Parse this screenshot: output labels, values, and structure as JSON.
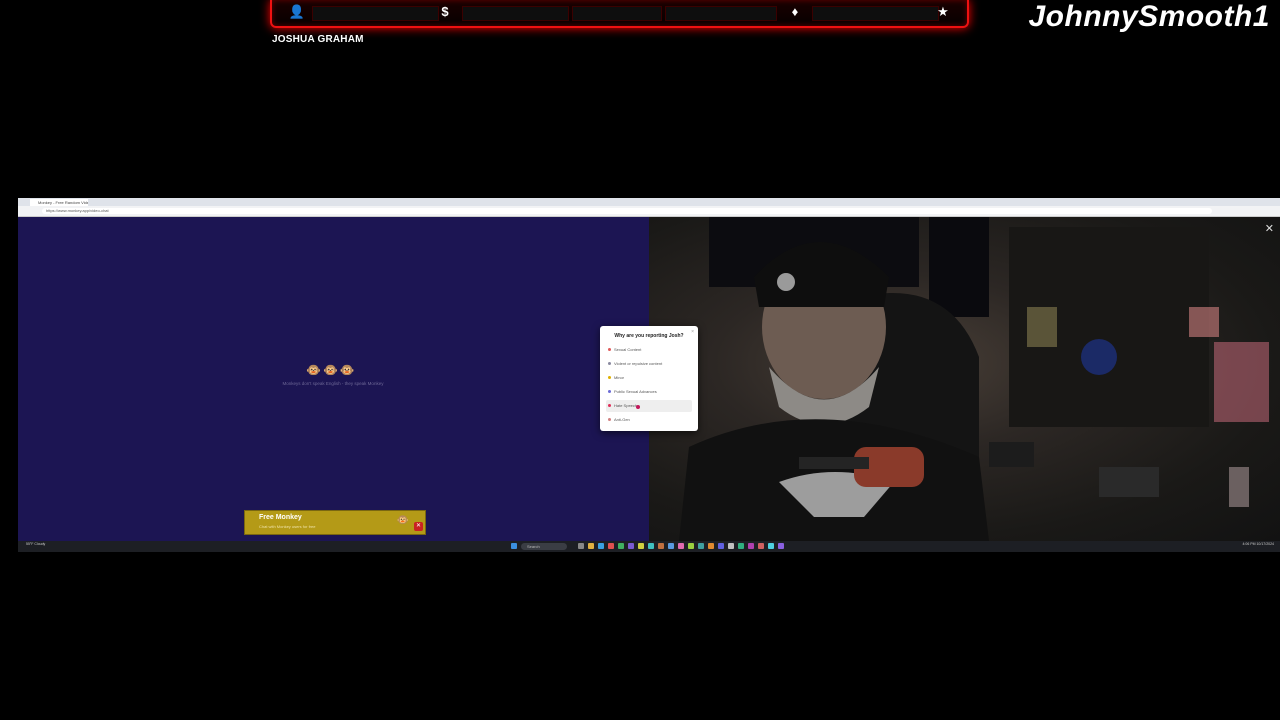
{
  "overlay": {
    "streamer_name": "JohnnySmooth1",
    "caption_name": "JOSHUA GRAHAM",
    "icons": [
      "user-icon",
      "dollar-icon",
      "diamond-icon",
      "star-icon"
    ],
    "icon_glyphs": {
      "user": "👤",
      "dollar": "$",
      "diamond": "♦",
      "star": "★"
    },
    "accent_color": "#ee1111"
  },
  "browser": {
    "tab_title": "Monkey - Free Random Video Chat",
    "address": "https://www.monkey.app/video-chat"
  },
  "page": {
    "monkeys": "🐵🐵🐵",
    "tagline": "Monkeys don't speak English - they speak Monkey",
    "ad": {
      "title": "Free Monkey",
      "subtitle": "Chat with Monkey users for free",
      "close": "✕"
    },
    "close_glyph": "✕",
    "left_bg": "#1c1553"
  },
  "report_modal": {
    "title": "Why are you reporting Josh?",
    "close": "×",
    "reasons": [
      {
        "label": "Sexual Content",
        "dot_color": "#e05a5a"
      },
      {
        "label": "Violent or repulsive content",
        "dot_color": "#8a8aa0"
      },
      {
        "label": "Minor",
        "dot_color": "#e0b000"
      },
      {
        "label": "Public Sexual Advances",
        "dot_color": "#6b6bd6"
      },
      {
        "label": "Hate Speech",
        "dot_color": "#e0305a",
        "hover": true
      },
      {
        "label": "Anti-Gen",
        "dot_color": "#d08080"
      }
    ]
  },
  "taskbar": {
    "search_placeholder": "Search",
    "tray_left": "55°F\nCloudy",
    "clock": "4:06 PM\n10/17/2024"
  }
}
